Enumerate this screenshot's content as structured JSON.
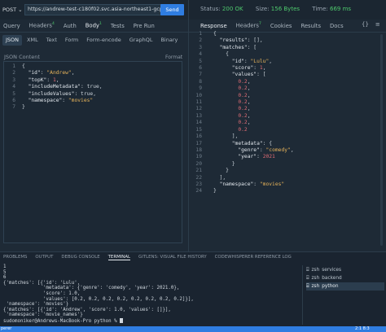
{
  "request": {
    "method": "POST",
    "url": "https://andrew-test-c180f02.svc.asia-northeast1-gcp.pinecone.io/query",
    "send_label": "Send",
    "tabs": [
      {
        "label": "Query",
        "badge": ""
      },
      {
        "label": "Headers",
        "badge": "4"
      },
      {
        "label": "Auth",
        "badge": ""
      },
      {
        "label": "Body",
        "badge": "1"
      },
      {
        "label": "Tests",
        "badge": ""
      },
      {
        "label": "Pre Run",
        "badge": ""
      }
    ],
    "body_tabs": [
      "JSON",
      "XML",
      "Text",
      "Form",
      "Form-encode",
      "GraphQL",
      "Binary"
    ],
    "content_label": "JSON Content",
    "format_label": "Format",
    "line_numbers": [
      "1",
      "2",
      "3",
      "4",
      "5",
      "6",
      "7"
    ],
    "code_lines": [
      "{",
      "  \"id\": \"Andrew\",",
      "  \"topK\": 1,",
      "  \"includeMetadata\": true,",
      "  \"includeValues\": true,",
      "  \"namespace\": \"movies\"",
      "}"
    ]
  },
  "response": {
    "status_label": "Status:",
    "status_value": "200 OK",
    "size_label": "Size:",
    "size_value": "156 Bytes",
    "time_label": "Time:",
    "time_value": "669 ms",
    "tabs": [
      {
        "label": "Response",
        "badge": ""
      },
      {
        "label": "Headers",
        "badge": "7"
      },
      {
        "label": "Cookies",
        "badge": ""
      },
      {
        "label": "Results",
        "badge": ""
      },
      {
        "label": "Docs",
        "badge": ""
      }
    ],
    "icons": [
      "braces-icon",
      "menu-icon"
    ],
    "line_numbers": [
      "1",
      "2",
      "3",
      "4",
      "5",
      "6",
      "7",
      "8",
      "9",
      "10",
      "11",
      "12",
      "13",
      "14",
      "15",
      "16",
      "17",
      "18",
      "19",
      "20",
      "21",
      "22",
      "23",
      "24"
    ],
    "code_lines": [
      "{",
      "  \"results\": [],",
      "  \"matches\": [",
      "    {",
      "      \"id\": \"Lulu\",",
      "      \"score\": 1,",
      "      \"values\": [",
      "        0.2,",
      "        0.2,",
      "        0.2,",
      "        0.2,",
      "        0.2,",
      "        0.2,",
      "        0.2,",
      "        0.2",
      "      ],",
      "      \"metadata\": {",
      "        \"genre\": \"comedy\",",
      "        \"year\": 2021",
      "      }",
      "    }",
      "  ],",
      "  \"namespace\": \"movies\"",
      "}"
    ]
  },
  "panel": {
    "tabs": [
      "PROBLEMS",
      "OUTPUT",
      "DEBUG CONSOLE",
      "TERMINAL",
      "GITLENS: VISUAL FILE HISTORY",
      "CODEWHISPERER REFERENCE LOG"
    ],
    "active_tab": "TERMINAL",
    "terminal_lines": [
      "1",
      "5",
      "6",
      "{'matches': [{'id': 'Lulu',",
      "              'metadata': {'genre': 'comedy', 'year': 2021.0},",
      "              'score': 1.0,",
      "              'values': [0.2, 0.2, 0.2, 0.2, 0.2, 0.2, 0.2, 0.2]}],",
      " 'namespace': 'movies'}",
      "{'matches': [{'id': 'Andrew', 'score': 1.0, 'values': []}],",
      " 'namespace': 'movie_names'}",
      "sudomoniker@Andrews-MacBook-Pro python % "
    ],
    "terminals": [
      {
        "name": "zsh",
        "label": "services"
      },
      {
        "name": "zsh",
        "label": "backend"
      },
      {
        "name": "zsh",
        "label": "python"
      }
    ]
  },
  "statusbar": {
    "left": "perer",
    "right": "2:1 8:3"
  }
}
